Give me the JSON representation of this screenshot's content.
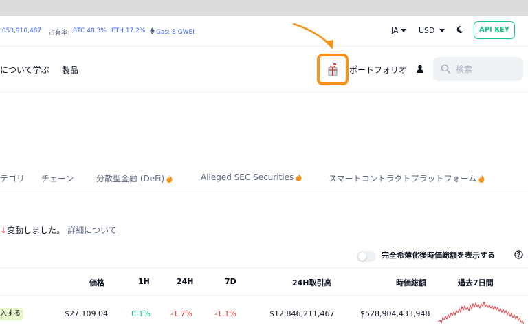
{
  "stats": {
    "market_cap_fragment": ",053,910,487",
    "dominance_label": "占有率:",
    "btc": "BTC 48.3%",
    "eth": "ETH 17.2%",
    "gas": "Gas: 8 GWEI"
  },
  "header": {
    "language": "JA",
    "currency": "USD",
    "api_key": "API KEY"
  },
  "nav": {
    "learn": "について学ぶ",
    "products": "製品",
    "portfolio": "ポートフォリオ",
    "search_placeholder": "検索"
  },
  "categories": [
    {
      "label": "テゴリ"
    },
    {
      "label": "チェーン"
    },
    {
      "label": "分散型金融 (DeFi)"
    },
    {
      "label": "Alleged SEC Securities"
    },
    {
      "label": "スマートコントラクトプラットフォーム"
    }
  ],
  "notice": {
    "arrow": "↓",
    "text": "変動しました。",
    "more": "詳細について"
  },
  "toggle": {
    "label": "完全希薄化後時価総額を表示する"
  },
  "table": {
    "headers": {
      "price": "価格",
      "h1": "1H",
      "h24": "24H",
      "d7": "7D",
      "volume": "24H取引高",
      "market_cap": "時価総額",
      "last7": "過去7日間"
    },
    "row": {
      "badge": "入する",
      "price": "$27,109.04",
      "h1": "0.1%",
      "h24": "-1.7%",
      "d7": "-1.1%",
      "volume": "$12,846,211,467",
      "market_cap": "$528,904,433,948"
    }
  },
  "colors": {
    "accent_green": "#16c784",
    "negative_red": "#ea3943",
    "highlight_orange": "#f7931a",
    "link_blue": "#3861fb"
  },
  "icons": [
    "eth-icon",
    "caret-down-icon",
    "moon-icon",
    "gift-icon",
    "user-icon",
    "search-icon",
    "flame-icon",
    "help-icon"
  ]
}
